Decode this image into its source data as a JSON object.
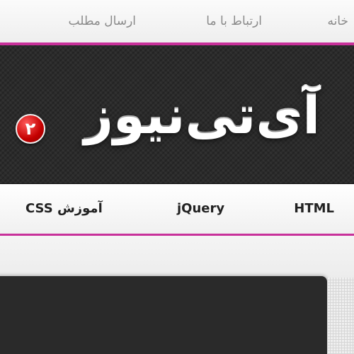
{
  "top_nav": {
    "home": "خانه",
    "contact": "ارتباط با ما",
    "submit_post": "ارسال مطلب"
  },
  "logo": {
    "text": "آی‌تی‌نیوز",
    "badge": "۲"
  },
  "main_nav": {
    "html": "HTML",
    "jquery": "jQuery",
    "css": "آموزش CSS"
  },
  "colors": {
    "accent": "#c8309a",
    "header_bg": "#2b2b2b",
    "badge": "#c40000"
  }
}
